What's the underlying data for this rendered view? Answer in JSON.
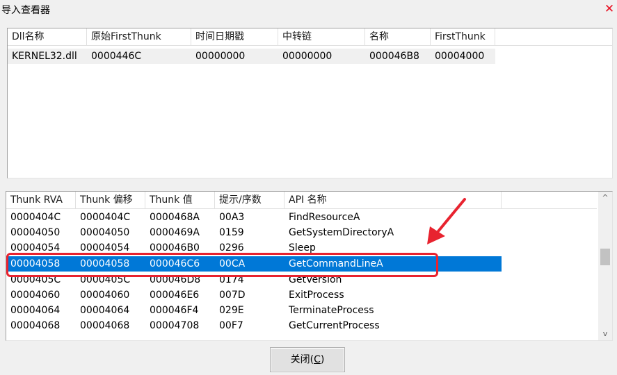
{
  "window": {
    "title": "导入查看器",
    "close_glyph": "✕"
  },
  "dll_table": {
    "columns": [
      "Dll名称",
      "原始FirstThunk",
      "时间日期戳",
      "中转链",
      "名称",
      "FirstThunk"
    ],
    "rows": [
      [
        "KERNEL32.dll",
        "0000446C",
        "00000000",
        "00000000",
        "000046B8",
        "00004000"
      ]
    ]
  },
  "thunk_table": {
    "columns": [
      "Thunk RVA",
      "Thunk 偏移",
      "Thunk 值",
      "提示/序数",
      "API 名称"
    ],
    "rows": [
      [
        "0000404C",
        "0000404C",
        "0000468A",
        "00A3",
        "FindResourceA"
      ],
      [
        "00004050",
        "00004050",
        "0000469A",
        "0159",
        "GetSystemDirectoryA"
      ],
      [
        "00004054",
        "00004054",
        "000046B0",
        "0296",
        "Sleep"
      ],
      [
        "00004058",
        "00004058",
        "000046C6",
        "00CA",
        "GetCommandLineA"
      ],
      [
        "0000405C",
        "0000405C",
        "000046D8",
        "0174",
        "GetVersion"
      ],
      [
        "00004060",
        "00004060",
        "000046E6",
        "007D",
        "ExitProcess"
      ],
      [
        "00004064",
        "00004064",
        "000046F4",
        "029E",
        "TerminateProcess"
      ],
      [
        "00004068",
        "00004068",
        "00004708",
        "00F7",
        "GetCurrentProcess"
      ]
    ],
    "selected_index": 3
  },
  "scrollbar": {
    "up_glyph": "^",
    "down_glyph": "v"
  },
  "footer": {
    "close_label": "关闭(",
    "close_accel": "C",
    "close_suffix": ")"
  },
  "colors": {
    "selection": "#0078d7",
    "annotation": "#e8232f"
  }
}
